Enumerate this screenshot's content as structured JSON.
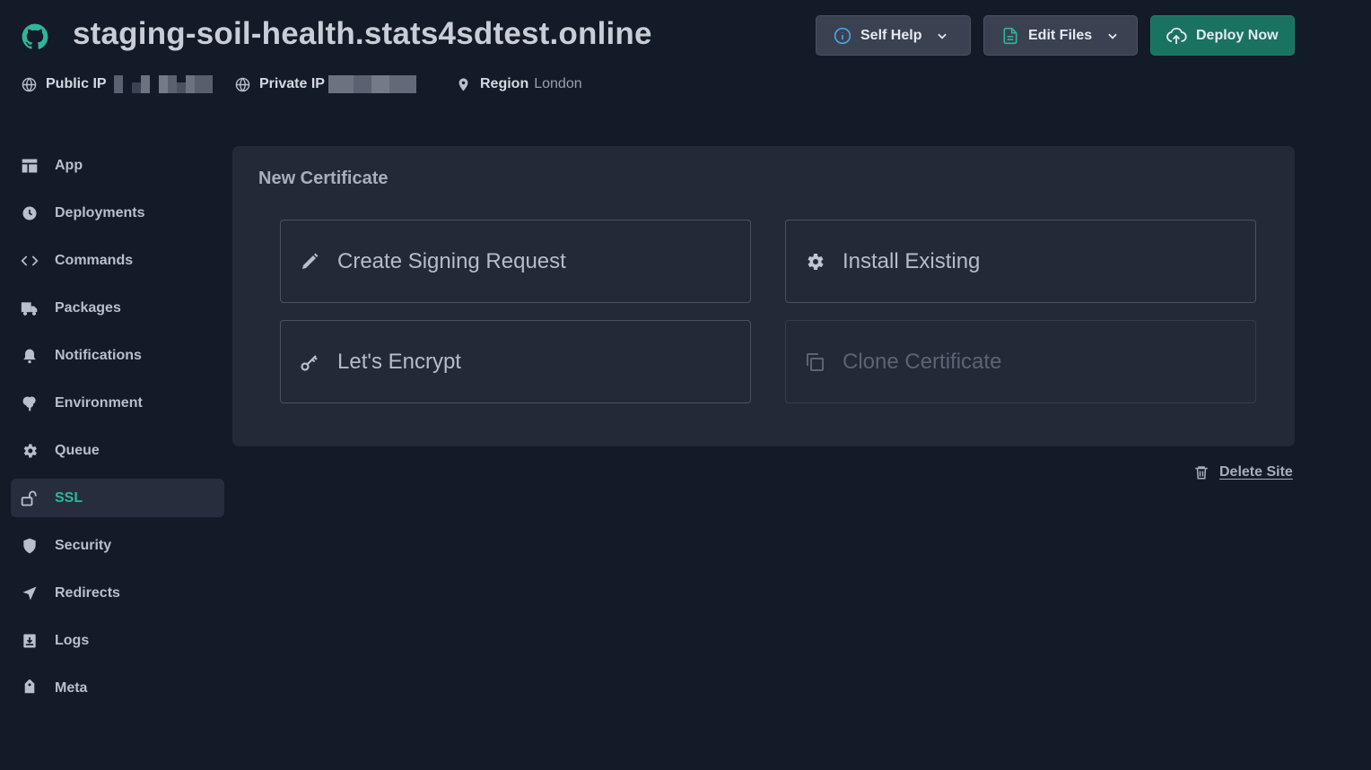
{
  "header": {
    "site_name": "staging-soil-health.stats4sdtest.online",
    "public_ip_label": "Public IP",
    "private_ip_label": "Private IP",
    "region_label": "Region",
    "region_value": "London"
  },
  "actions": {
    "self_help": "Self Help",
    "edit_files": "Edit Files",
    "deploy_now": "Deploy Now"
  },
  "sidebar": {
    "items": [
      {
        "label": "App",
        "icon": "app-layout-icon"
      },
      {
        "label": "Deployments",
        "icon": "clock-icon"
      },
      {
        "label": "Commands",
        "icon": "code-icon"
      },
      {
        "label": "Packages",
        "icon": "truck-icon"
      },
      {
        "label": "Notifications",
        "icon": "bell-icon"
      },
      {
        "label": "Environment",
        "icon": "tree-icon"
      },
      {
        "label": "Queue",
        "icon": "gear-icon"
      },
      {
        "label": "SSL",
        "icon": "unlock-icon",
        "active": true
      },
      {
        "label": "Security",
        "icon": "shield-icon"
      },
      {
        "label": "Redirects",
        "icon": "navigation-icon"
      },
      {
        "label": "Logs",
        "icon": "archive-icon"
      },
      {
        "label": "Meta",
        "icon": "tag-icon"
      }
    ]
  },
  "certificate": {
    "title": "New Certificate",
    "options": [
      {
        "label": "Create Signing Request",
        "icon": "pencil-icon"
      },
      {
        "label": "Install Existing",
        "icon": "gear-icon"
      },
      {
        "label": "Let's Encrypt",
        "icon": "key-icon"
      },
      {
        "label": "Clone Certificate",
        "icon": "copy-icon",
        "disabled": true
      }
    ]
  },
  "delete_site": "Delete Site",
  "colors": {
    "background": "#131a28",
    "card": "#222a38",
    "accent": "#2fb59a",
    "deploy_button": "#1a7261"
  }
}
